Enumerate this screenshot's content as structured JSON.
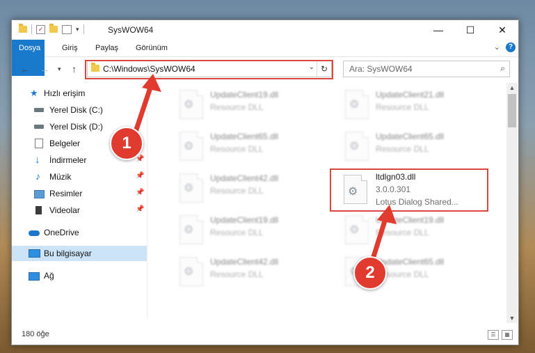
{
  "window": {
    "title": "SysWOW64",
    "controls": {
      "minimize": "—",
      "maximize": "☐",
      "close": "✕"
    }
  },
  "ribbon": {
    "tabs": [
      "Dosya",
      "Giriş",
      "Paylaş",
      "Görünüm"
    ],
    "help": "?"
  },
  "address": {
    "path": "C:\\Windows\\SysWOW64",
    "search_placeholder": "Ara: SysWOW64"
  },
  "nav": {
    "items": [
      {
        "label": "Hızlı erişim",
        "icon": "star-icon"
      },
      {
        "label": "Yerel Disk (C:)",
        "icon": "drive-icon"
      },
      {
        "label": "Yerel Disk (D:)",
        "icon": "drive-icon"
      },
      {
        "label": "Belgeler",
        "icon": "documents-icon"
      },
      {
        "label": "İndirmeler",
        "icon": "downloads-icon"
      },
      {
        "label": "Müzik",
        "icon": "music-icon"
      },
      {
        "label": "Resimler",
        "icon": "pictures-icon"
      },
      {
        "label": "Videolar",
        "icon": "videos-icon"
      },
      {
        "label": "OneDrive",
        "icon": "cloud-icon"
      },
      {
        "label": "Bu bilgisayar",
        "icon": "computer-icon"
      },
      {
        "label": "Ağ",
        "icon": "network-icon"
      }
    ]
  },
  "files": [
    {
      "name": "UpdateClient19.dll",
      "desc": "Resource DLL"
    },
    {
      "name": "UpdateClient21.dll",
      "desc": "Resource DLL"
    },
    {
      "name": "UpdateClient65.dll",
      "desc": "Resource DLL"
    },
    {
      "name": "UpdateClient65.dll",
      "desc": "Resource DLL"
    },
    {
      "name": "UpdateClient42.dll",
      "desc": "Resource DLL"
    },
    {
      "name": "ltdlgn03.dll",
      "version": "3.0.0.301",
      "desc": "Lotus Dialog Shared..."
    },
    {
      "name": "UpdateClient19.dll",
      "desc": "Resource DLL"
    },
    {
      "name": "UpdateClient19.dll",
      "desc": "Resource DLL"
    },
    {
      "name": "UpdateClient42.dll",
      "desc": "Resource DLL"
    },
    {
      "name": "UpdateClient65.dll",
      "desc": "Resource DLL"
    }
  ],
  "status": {
    "count": "180 öğe"
  },
  "annotations": {
    "step1": "1",
    "step2": "2"
  },
  "colors": {
    "accent": "#1979ca",
    "highlight": "#d9473e",
    "badge": "#e03b2e"
  }
}
